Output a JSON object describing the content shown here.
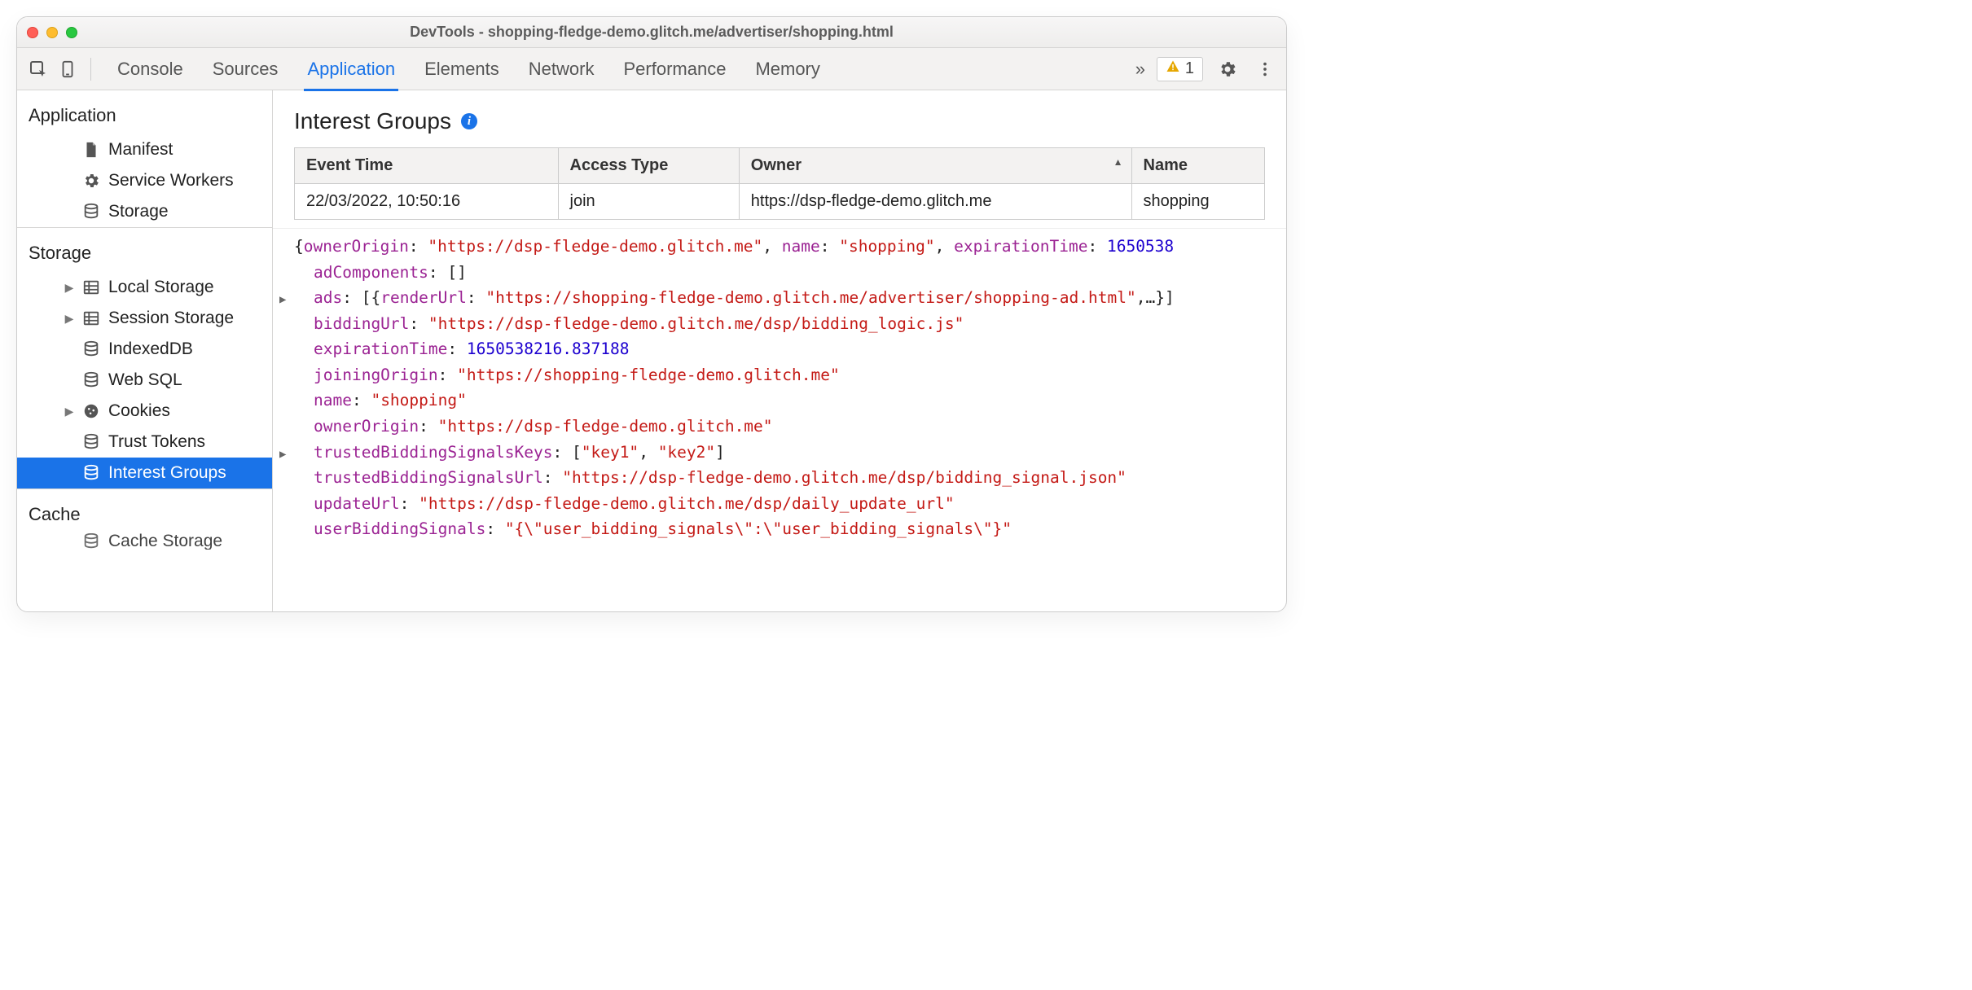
{
  "window": {
    "title": "DevTools - shopping-fledge-demo.glitch.me/advertiser/shopping.html"
  },
  "toolbar": {
    "tabs": [
      "Console",
      "Sources",
      "Application",
      "Elements",
      "Network",
      "Performance",
      "Memory"
    ],
    "activeTab": "Application",
    "warningCount": "1"
  },
  "sidebar": {
    "groups": [
      {
        "title": "Application",
        "items": [
          {
            "label": "Manifest",
            "icon": "document-icon"
          },
          {
            "label": "Service Workers",
            "icon": "gear-icon"
          },
          {
            "label": "Storage",
            "icon": "db-icon"
          }
        ]
      },
      {
        "title": "Storage",
        "items": [
          {
            "label": "Local Storage",
            "icon": "grid-icon",
            "expandable": true
          },
          {
            "label": "Session Storage",
            "icon": "grid-icon",
            "expandable": true
          },
          {
            "label": "IndexedDB",
            "icon": "db-icon"
          },
          {
            "label": "Web SQL",
            "icon": "db-icon"
          },
          {
            "label": "Cookies",
            "icon": "cookie-icon",
            "expandable": true
          },
          {
            "label": "Trust Tokens",
            "icon": "db-icon"
          },
          {
            "label": "Interest Groups",
            "icon": "db-icon",
            "selected": true
          }
        ]
      },
      {
        "title": "Cache",
        "items": [
          {
            "label": "Cache Storage",
            "icon": "db-icon",
            "cut": true
          }
        ]
      }
    ]
  },
  "panel": {
    "heading": "Interest Groups",
    "table": {
      "headers": [
        "Event Time",
        "Access Type",
        "Owner",
        "Name"
      ],
      "sortedCol": 2,
      "rows": [
        [
          "22/03/2022, 10:50:16",
          "join",
          "https://dsp-fledge-demo.glitch.me",
          "shopping"
        ]
      ]
    },
    "object": {
      "summaryLine": "{ownerOrigin: \"https://dsp-fledge-demo.glitch.me\", name: \"shopping\", expirationTime: 1650538",
      "props": [
        {
          "key": "adComponents",
          "type": "pun",
          "value": "[]"
        },
        {
          "key": "ads",
          "type": "mixed",
          "expandable": true,
          "value": "[{renderUrl: \"https://shopping-fledge-demo.glitch.me/advertiser/shopping-ad.html\",…}]"
        },
        {
          "key": "biddingUrl",
          "type": "str",
          "value": "\"https://dsp-fledge-demo.glitch.me/dsp/bidding_logic.js\""
        },
        {
          "key": "expirationTime",
          "type": "num",
          "value": "1650538216.837188"
        },
        {
          "key": "joiningOrigin",
          "type": "str",
          "value": "\"https://shopping-fledge-demo.glitch.me\""
        },
        {
          "key": "name",
          "type": "str",
          "value": "\"shopping\""
        },
        {
          "key": "ownerOrigin",
          "type": "str",
          "value": "\"https://dsp-fledge-demo.glitch.me\""
        },
        {
          "key": "trustedBiddingSignalsKeys",
          "type": "mixed",
          "expandable": true,
          "value": "[\"key1\", \"key2\"]"
        },
        {
          "key": "trustedBiddingSignalsUrl",
          "type": "str",
          "value": "\"https://dsp-fledge-demo.glitch.me/dsp/bidding_signal.json\""
        },
        {
          "key": "updateUrl",
          "type": "str",
          "value": "\"https://dsp-fledge-demo.glitch.me/dsp/daily_update_url\""
        },
        {
          "key": "userBiddingSignals",
          "type": "str",
          "value": "\"{\\\"user_bidding_signals\\\":\\\"user_bidding_signals\\\"}\""
        }
      ]
    }
  }
}
